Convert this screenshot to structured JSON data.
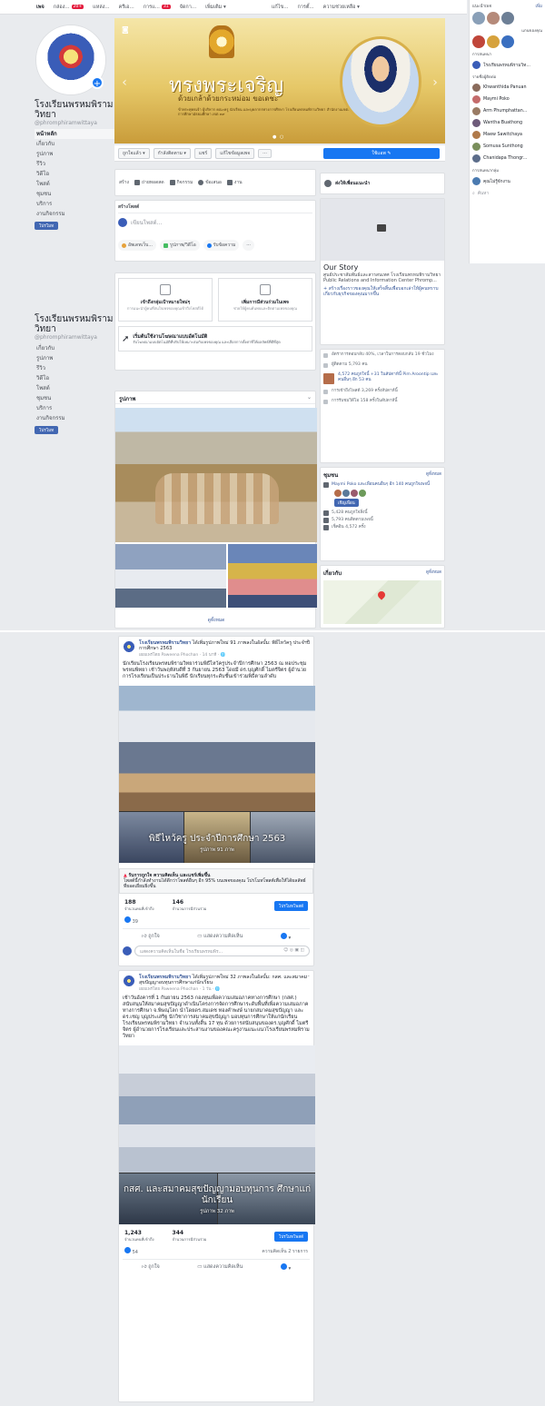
{
  "topbar": {
    "items": [
      {
        "label": "เพจ",
        "active": true
      },
      {
        "label": "กล่อง...",
        "badge": "20+"
      },
      {
        "label": "แหล่ง..."
      },
      {
        "label": "ครีเอ..."
      },
      {
        "label": "การแ...",
        "badge": "31"
      },
      {
        "label": "จัดกา..."
      },
      {
        "label": "เพิ่มเติม ▾"
      }
    ],
    "right": [
      {
        "label": "แก้ไข..."
      },
      {
        "label": "การตั้..."
      },
      {
        "label": "ความช่วยเหลือ ▾"
      }
    ]
  },
  "chat": {
    "header_left": "แนะนำเพจ",
    "header_right": "เพิ่ม",
    "section_groups": "แกนของคุณ",
    "section_people": "การสนทนา",
    "section_contacts": "รายชื่อผู้ติดต่อ",
    "contacts": [
      "โรงเรียนพรหมพิรามวิท...",
      "Khwanthida Panuan",
      "Maymi Poko",
      "Arm Phumphattan...",
      "Wantha Buathong",
      "Maew Sawitchaya",
      "Somusa Sunthong",
      "Chanidapa Thongr..."
    ],
    "section_group_chats": "การสนทนากลุ่ม",
    "group_chat": "คุณไม่รู้จักงาน",
    "search": "ค้นหา"
  },
  "left_nav": {
    "page_name": "โรงเรียนพรหมพิราม วิทยา",
    "handle": "@phromphiramwittaya",
    "items": [
      "หน้าหลัก",
      "เกี่ยวกับ",
      "รูปภาพ",
      "รีวิว",
      "วิดีโอ",
      "โพสต์",
      "ชุมชน",
      "บริการ",
      "งานกิจกรรม"
    ],
    "promote": "โปรโมท"
  },
  "cover": {
    "title": "ทรงพระเจริญ",
    "subtitle": "ด้วยเกล้าด้วยกระหม่อม ขอเดชะ",
    "small_lines": "ข้าพระพุทธเจ้า ผู้บริหาร คณะครู นักเรียน และบุคลากรทางการศึกษา โรงเรียนพรหมพิรามวิทยา สำนักงานเขตพื้นที่การศึกษามัธยมศึกษา เขต ๓๙"
  },
  "action_bar": {
    "buttons": [
      "ถูกใจแล้ว ▾",
      "กำลังติดตาม ▾",
      "แชร์",
      "แก้ไขข้อมูลเพจ",
      "···"
    ],
    "primary": "ใช้แอพ ✎"
  },
  "tabs": [
    "สร้าง",
    "ถ่ายทอดสด",
    "กิจกรรม",
    "ข้อเสนอ",
    "งาน"
  ],
  "composer": {
    "header": "สร้างโพสต์",
    "placeholder": "เขียนโพสต์...",
    "pills": [
      "อัพเดทเว็บ...",
      "รูปภาพ/วิดีโอ",
      "รับข้อความ",
      "···"
    ]
  },
  "info_boxes": [
    {
      "title": "เข้าถึงกลุ่มเป้าหมายใหม่ๆ",
      "desc": "การแนะนำผู้คนที่สนใจเพจของคุณเข้าถึงโพสต์ได้"
    },
    {
      "title": "เพิ่มการมีส่วนร่วมในเพจ",
      "desc": "ช่วยให้ผู้คนค้นพบและติดตามเพจของคุณ"
    }
  ],
  "ad_box": {
    "title": "เริ่มต้นใช้งานโฆษณาแบบอัตโนมัติ",
    "desc": "รับโฆษณาแบบอัตโนมัติที่ปรับให้เหมาะสมกับเพจของคุณ และเลือกการตั้งค่าที่ให้ผลลัพธ์ที่ดีที่สุด"
  },
  "photos": {
    "header": "รูปภาพ",
    "more": "ดูทั้งหมด"
  },
  "right": {
    "invite": {
      "label": "ส่งให้เพื่อนแนะนำ"
    },
    "story": {
      "title": "Our Story",
      "text": "ศูนย์ประชาสัมพันธ์และสารสนเทศ โรงเรียนพรหมพิรามวิทยา",
      "text2": "Public Relations and Information Center Phromp...",
      "link": "+ สร้างเรื่องราวของคุณให้เสร็จสิ้นเพื่อบอกเล่าให้ผู้คนทราบเกี่ยวกับธุรกิจของคุณมากขึ้น"
    },
    "about_rows": [
      "อัตราการตอบกลับ 40%, เวลาในการตอบกลับ 19 ชั่วโมง",
      "ผู้ติดตาม 5,793 คน",
      "4,572 คนถูกใจนี้ +31 ในสัปดาห์นี้ Pim Aroontip และคนอื่นๆ อีก 53 คน",
      "การเข้าถึงโพสต์ 3,269 ครั้งสัปดาห์นี้",
      "การรับชมวิดีโอ 158 ครั้งในสัปดาห์นี้"
    ],
    "community": {
      "title": "ชุมชน",
      "see_all": "ดูทั้งหมด",
      "invite_text": "Maymi Poko และเพื่อนคนอื่นๆ อีก 140 คนถูกใจเพจนี้",
      "invite_btn": "เชิญเพื่อน",
      "rows": [
        "5,428 คนถูกใจสิ่งนี้",
        "5,793 คนติดตามเพจนี้",
        "เช็คอิน 4,572 ครั้ง"
      ]
    },
    "about_map": {
      "title": "เกี่ยวกับ",
      "see_all": "ดูทั้งหมด"
    }
  },
  "posts": [
    {
      "page": "โรงเรียนพรหมพิรามวิทยา",
      "action": "ได้เพิ่มรูปภาพใหม่ 91 ภาพลงในอัลบั้ม: พิธีไหว้ครู ประจำปีการศึกษา 2563",
      "meta": "เผยแพร่โดย Paweena Phochan · 14 นาที · 🌐",
      "body": "นักเรียนโรงเรียนพรหมพิรามวิทยาร่วมพิธีไหว้ครูประจำปีการศึกษา 2563 ณ หอประชุมพรหมพิทยา เช้าวันพฤหัสบดีที่ 3 กันยายน 2563 โดยมี ดร.บุญศักดิ์ ไมตรีจิตร ผู้อำนวยการโรงเรียนเป็นประธานในพิธี นักเรียนทุกระดับชั้นเข้าร่วมพิธีตามลำดับ",
      "album_title": "พิธีไหว้ครู ประจำปีการศึกษา 2563",
      "album_count": "รูปภาพ 91 ภาพ",
      "boost_title": "รับการถูกใจ ความคิดเห็น และแชร์เพิ่มขึ้น",
      "boost_text": "โพสต์นี้กำลังทำงานได้ดีกว่าโพสต์อื่นๆ อีก 95% บนเพจของคุณ โปรโมทโพสต์เพื่อให้ได้ผลลัพธ์ที่ยอดเยี่ยมยิ่งขึ้น",
      "reached": "188",
      "reached_label": "จำนวนคนที่เข้าถึง",
      "engagement": "146",
      "engagement_label": "จำนวนการมีส่วนร่วม",
      "boost_btn": "โปรโมทโพสต์",
      "likes": "39",
      "comments_count": "",
      "like_label": "ถูกใจ",
      "comment_label": "แสดงความคิดเห็น",
      "comment_placeholder": "แสดงความคิดเห็นในชื่อ โรงเรียนพรหมพิร..."
    },
    {
      "page": "โรงเรียนพรหมพิรามวิทยา",
      "action": "ได้เพิ่มรูปภาพใหม่ 32 ภาพลงในอัลบั้ม: กสศ. และสมาคมสุขปัญญาอบทุนการศึกษาแก่นักเรียน",
      "meta": "เผยแพร่โดย Paweena Phochan · 1 วัน · 🌐",
      "body": "เช้าวันอังคารที่ 1 กันยายน 2563 กองทุนเพื่อความเสมอภาคทางการศึกษา (กสศ.) สนับสนุนให้สมาคมสุขปัญญาดำเนินโครงการจัดการศึกษาระดับพื้นที่เพื่อความเสมอภาคทางการศึกษา จ.พิษณุโลก นำโดยดร.สมเดช ทองคำพงษ์ นายกสมาคมสุขปัญญา และดร.เชญ บุญประเสริฐ นักวิชาการสมาคมสุขปัญญา มอบทุนการศึกษาให้แก่นักเรียนโรงเรียนพรหมพิรามวิทยา จำนวนทั้งสิ้น 17 ทุน ด้วยการสนับสนุนของดร.บุญศักดิ์ ไมตรีจิตร ผู้อำนวยการโรงเรียนและประสานงานของคณะครูงานแนะแนวโรงเรียนพรหมพิรามวิทยา",
      "album_title": "กสศ. และสมาคมสุขปัญญามอบทุนการ ศึกษาแก่นักเรียน",
      "album_count": "รูปภาพ 32 ภาพ",
      "reached": "1,243",
      "reached_label": "จำนวนคนที่เข้าถึง",
      "engagement": "344",
      "engagement_label": "จำนวนการมีส่วนร่วม",
      "boost_btn": "โปรโมทโพสต์",
      "likes": "54",
      "comments_count": "ความคิดเห็น 2 รายการ",
      "like_label": "ถูกใจ",
      "comment_label": "แสดงความคิดเห็น"
    }
  ]
}
